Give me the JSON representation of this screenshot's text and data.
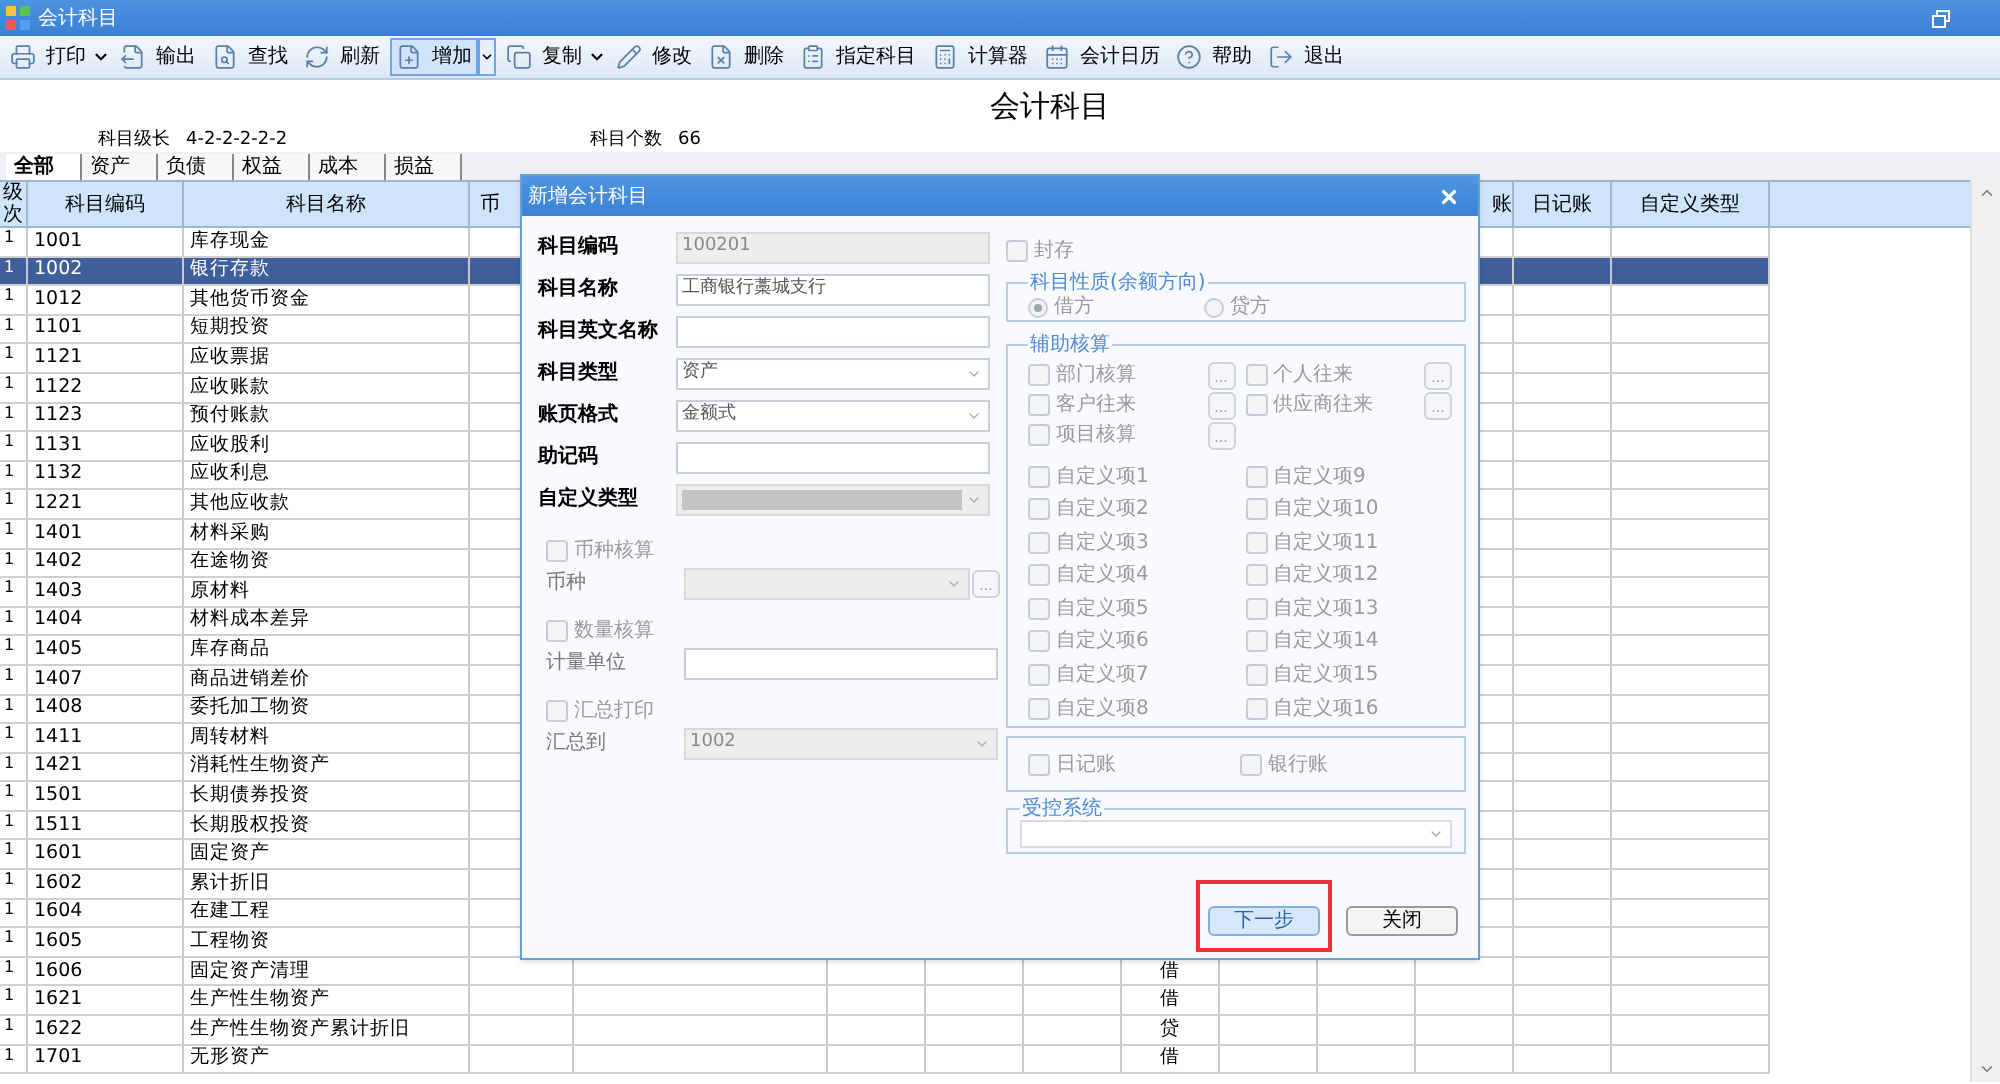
{
  "window": {
    "title": "会计科目"
  },
  "toolbar": [
    {
      "label": "打印",
      "dropdown": true,
      "selected": false
    },
    {
      "label": "输出",
      "dropdown": false,
      "selected": false
    },
    {
      "label": "查找",
      "dropdown": false,
      "selected": false
    },
    {
      "label": "刷新",
      "dropdown": false,
      "selected": false
    },
    {
      "label": "增加",
      "dropdown": true,
      "selected": true
    },
    {
      "label": "复制",
      "dropdown": true,
      "selected": false
    },
    {
      "label": "修改",
      "dropdown": false,
      "selected": false
    },
    {
      "label": "删除",
      "dropdown": false,
      "selected": false
    },
    {
      "label": "指定科目",
      "dropdown": false,
      "selected": false
    },
    {
      "label": "计算器",
      "dropdown": false,
      "selected": false
    },
    {
      "label": "会计日历",
      "dropdown": false,
      "selected": false
    },
    {
      "label": "帮助",
      "dropdown": false,
      "selected": false
    },
    {
      "label": "退出",
      "dropdown": false,
      "selected": false
    }
  ],
  "page_title": "会计科目",
  "info": [
    {
      "label": "科目级长",
      "value": "4-2-2-2-2-2"
    },
    {
      "label": "科目个数",
      "value": "66"
    }
  ],
  "tabs": [
    {
      "label": "全部",
      "selected": true
    },
    {
      "label": "资产",
      "selected": false
    },
    {
      "label": "负债",
      "selected": false
    },
    {
      "label": "权益",
      "selected": false
    },
    {
      "label": "成本",
      "selected": false
    },
    {
      "label": "损益",
      "selected": false
    }
  ],
  "table": {
    "columns": [
      "级次",
      "科目编码",
      "科目名称",
      "币",
      "账",
      "日记账",
      "自定义类型"
    ],
    "rows": [
      {
        "level": "1",
        "code": "1001",
        "name": "库存现金",
        "selected": false
      },
      {
        "level": "1",
        "code": "1002",
        "name": "银行存款",
        "selected": true
      },
      {
        "level": "1",
        "code": "1012",
        "name": "其他货币资金",
        "selected": false
      },
      {
        "level": "1",
        "code": "1101",
        "name": "短期投资",
        "selected": false
      },
      {
        "level": "1",
        "code": "1121",
        "name": "应收票据",
        "selected": false
      },
      {
        "level": "1",
        "code": "1122",
        "name": "应收账款",
        "selected": false
      },
      {
        "level": "1",
        "code": "1123",
        "name": "预付账款",
        "selected": false
      },
      {
        "level": "1",
        "code": "1131",
        "name": "应收股利",
        "selected": false
      },
      {
        "level": "1",
        "code": "1132",
        "name": "应收利息",
        "selected": false
      },
      {
        "level": "1",
        "code": "1221",
        "name": "其他应收款",
        "selected": false
      },
      {
        "level": "1",
        "code": "1401",
        "name": "材料采购",
        "selected": false
      },
      {
        "level": "1",
        "code": "1402",
        "name": "在途物资",
        "selected": false
      },
      {
        "level": "1",
        "code": "1403",
        "name": "原材料",
        "selected": false
      },
      {
        "level": "1",
        "code": "1404",
        "name": "材料成本差异",
        "selected": false
      },
      {
        "level": "1",
        "code": "1405",
        "name": "库存商品",
        "selected": false
      },
      {
        "level": "1",
        "code": "1407",
        "name": "商品进销差价",
        "selected": false
      },
      {
        "level": "1",
        "code": "1408",
        "name": "委托加工物资",
        "selected": false
      },
      {
        "level": "1",
        "code": "1411",
        "name": "周转材料",
        "selected": false
      },
      {
        "level": "1",
        "code": "1421",
        "name": "消耗性生物资产",
        "selected": false
      },
      {
        "level": "1",
        "code": "1501",
        "name": "长期债券投资",
        "selected": false
      },
      {
        "level": "1",
        "code": "1511",
        "name": "长期股权投资",
        "selected": false
      },
      {
        "level": "1",
        "code": "1601",
        "name": "固定资产",
        "selected": false
      },
      {
        "level": "1",
        "code": "1602",
        "name": "累计折旧",
        "selected": false
      },
      {
        "level": "1",
        "code": "1604",
        "name": "在建工程",
        "selected": false
      },
      {
        "level": "1",
        "code": "1605",
        "name": "工程物资",
        "selected": false
      },
      {
        "level": "1",
        "code": "1606",
        "name": "固定资产清理",
        "direction": "借",
        "selected": false
      },
      {
        "level": "1",
        "code": "1621",
        "name": "生产性生物资产",
        "direction": "借",
        "selected": false
      },
      {
        "level": "1",
        "code": "1622",
        "name": "生产性生物资产累计折旧",
        "direction": "贷",
        "selected": false
      },
      {
        "level": "1",
        "code": "1701",
        "name": "无形资产",
        "direction": "借",
        "selected": false
      }
    ]
  },
  "dialog": {
    "title": "新增会计科目",
    "left": [
      {
        "kind": "text",
        "label": "科目编码",
        "value": "100201",
        "disabled": true
      },
      {
        "kind": "text",
        "label": "科目名称",
        "value": "工商银行藁城支行",
        "disabled": false
      },
      {
        "kind": "text",
        "label": "科目英文名称",
        "disabled": false
      },
      {
        "kind": "select",
        "label": "科目类型",
        "value": "资产",
        "disabled": false
      },
      {
        "kind": "select",
        "label": "账页格式",
        "value": "金额式",
        "disabled": false
      },
      {
        "kind": "text",
        "label": "助记码",
        "disabled": false
      },
      {
        "kind": "select",
        "label": "自定义类型",
        "disabled": true
      },
      {
        "kind": "checkbox",
        "label": "币种核算",
        "checked": false
      },
      {
        "kind": "select",
        "label": "币种",
        "disabled": true,
        "more": "..."
      },
      {
        "kind": "checkbox",
        "label": "数量核算",
        "checked": false
      },
      {
        "kind": "text",
        "label": "计量单位",
        "disabled": false
      },
      {
        "kind": "checkbox",
        "label": "汇总打印",
        "checked": false
      },
      {
        "kind": "select",
        "label": "汇总到",
        "value": "1002",
        "disabled": true
      }
    ],
    "sealed": {
      "label": "封存",
      "checked": false
    },
    "nature": {
      "title": "科目性质(余额方向)",
      "options": [
        {
          "label": "借方",
          "selected": true
        },
        {
          "label": "贷方",
          "selected": false
        }
      ]
    },
    "auxiliary": {
      "title": "辅助核算",
      "items": [
        {
          "label": "部门核算",
          "checked": false,
          "more": "..."
        },
        {
          "label": "个人往来",
          "checked": false,
          "more": "..."
        },
        {
          "label": "客户往来",
          "checked": false,
          "more": "..."
        },
        {
          "label": "供应商往来",
          "checked": false,
          "more": "..."
        },
        {
          "label": "项目核算",
          "checked": false,
          "more": "..."
        }
      ],
      "custom": [
        {
          "label": "自定义项1",
          "checked": false
        },
        {
          "label": "自定义项9",
          "checked": false
        },
        {
          "label": "自定义项2",
          "checked": false
        },
        {
          "label": "自定义项10",
          "checked": false
        },
        {
          "label": "自定义项3",
          "checked": false
        },
        {
          "label": "自定义项11",
          "checked": false
        },
        {
          "label": "自定义项4",
          "checked": false
        },
        {
          "label": "自定义项12",
          "checked": false
        },
        {
          "label": "自定义项5",
          "checked": false
        },
        {
          "label": "自定义项13",
          "checked": false
        },
        {
          "label": "自定义项6",
          "checked": false
        },
        {
          "label": "自定义项14",
          "checked": false
        },
        {
          "label": "自定义项7",
          "checked": false
        },
        {
          "label": "自定义项15",
          "checked": false
        },
        {
          "label": "自定义项8",
          "checked": false
        },
        {
          "label": "自定义项16",
          "checked": false
        }
      ]
    },
    "books": [
      {
        "label": "日记账",
        "checked": false
      },
      {
        "label": "银行账",
        "checked": false
      }
    ],
    "controlled": {
      "title": "受控系统"
    },
    "buttons": [
      {
        "label": "下一步",
        "primary": true,
        "highlighted": true
      },
      {
        "label": "关闭",
        "primary": false,
        "highlighted": false
      }
    ]
  }
}
